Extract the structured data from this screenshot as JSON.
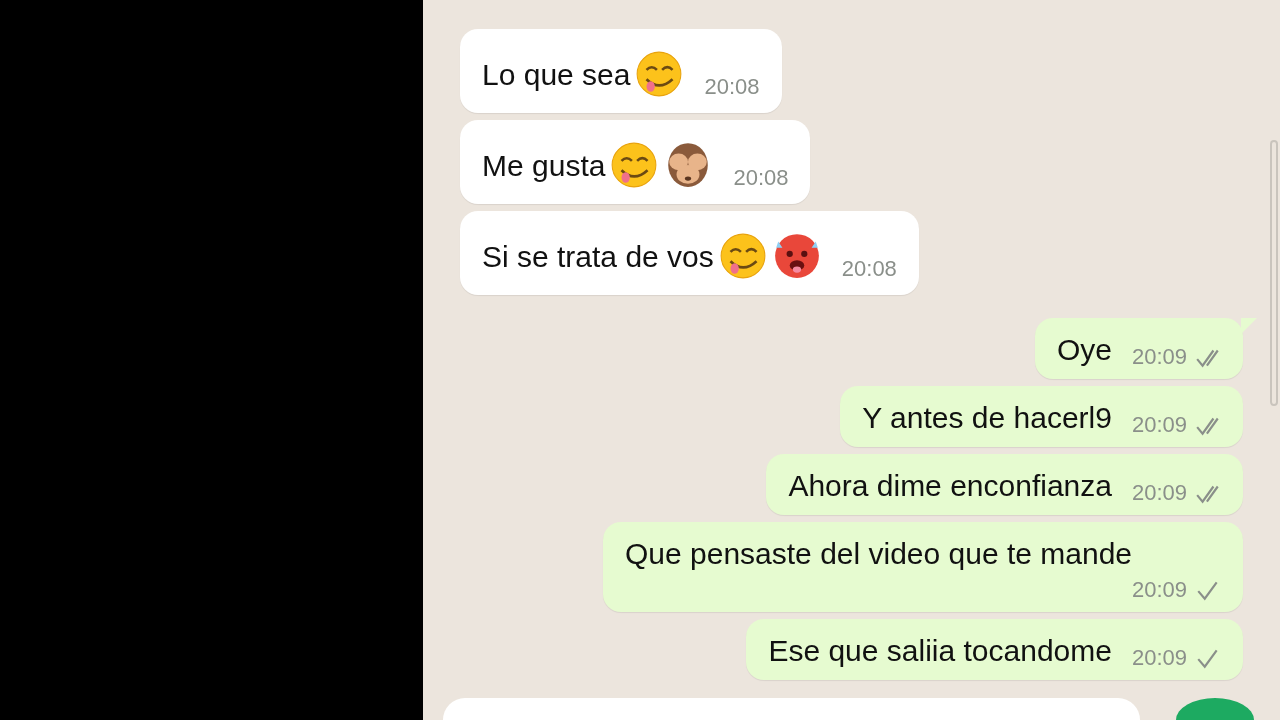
{
  "messages": [
    {
      "kind": "incoming",
      "text": "Lo que sea",
      "emojis": [
        {
          "kind": "savoring"
        }
      ],
      "time": "20:08"
    },
    {
      "kind": "incoming",
      "text": "Me gusta",
      "emojis": [
        {
          "kind": "savoring"
        },
        {
          "kind": "monkey"
        }
      ],
      "time": "20:08"
    },
    {
      "kind": "incoming",
      "text": "Si se trata de vos",
      "emojis": [
        {
          "kind": "savoring"
        },
        {
          "kind": "hot"
        }
      ],
      "time": "20:08"
    },
    {
      "kind": "outgoing",
      "text": "Oye",
      "time": "20:09",
      "delivered": true,
      "tail": true
    },
    {
      "kind": "outgoing",
      "text": "Y antes de hacerl9",
      "time": "20:09",
      "delivered": true
    },
    {
      "kind": "outgoing",
      "text": "Ahora dime enconfianza",
      "time": "20:09",
      "delivered": true
    },
    {
      "kind": "outgoing",
      "text": "Que pensaste del video que te mande",
      "time": "20:09",
      "delivered": false
    },
    {
      "kind": "outgoing",
      "text": "Ese que saliia tocandome",
      "time": "20:09",
      "delivered": false
    }
  ]
}
